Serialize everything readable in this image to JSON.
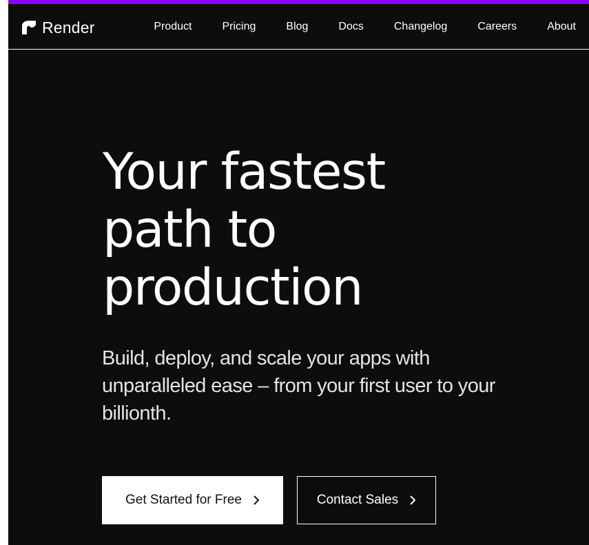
{
  "colors": {
    "accent": "#8a05ff",
    "background": "#0d0d0d",
    "text": "#ffffff"
  },
  "header": {
    "brand_name": "Render",
    "logo_icon": "render-logo-icon",
    "nav": [
      {
        "label": "Product"
      },
      {
        "label": "Pricing"
      },
      {
        "label": "Blog"
      },
      {
        "label": "Docs"
      },
      {
        "label": "Changelog"
      },
      {
        "label": "Careers"
      },
      {
        "label": "About"
      }
    ]
  },
  "hero": {
    "title_lines": [
      "Your fastest",
      "path to",
      "production"
    ],
    "subtitle": "Build, deploy, and scale your apps with unparalleled ease – from your first user to your billionth.",
    "cta_primary": {
      "label": "Get Started for Free",
      "icon": "chevron-right-icon"
    },
    "cta_secondary": {
      "label": "Contact Sales",
      "icon": "chevron-right-icon"
    }
  }
}
